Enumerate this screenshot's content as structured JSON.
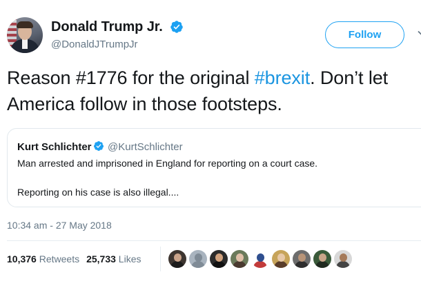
{
  "author": {
    "display_name": "Donald Trump Jr.",
    "handle": "@DonaldJTrumpJr",
    "verified": true,
    "avatar_icon": "profile-photo"
  },
  "follow_button": {
    "label": "Follow"
  },
  "tweet": {
    "text_part1": "Reason #1776 for the original ",
    "hashtag": "#brexit",
    "text_part2": ". Don’t let America follow in those footsteps."
  },
  "quoted_tweet": {
    "display_name": "Kurt Schlichter",
    "handle": "@KurtSchlichter",
    "verified": true,
    "line1": "Man arrested and imprisoned in England for reporting on a court case.",
    "line2": "Reporting on his case is also illegal...."
  },
  "timestamp": "10:34 am - 27 May 2018",
  "stats": {
    "retweets_count": "10,376",
    "retweets_label": "Retweets",
    "likes_count": "25,733",
    "likes_label": "Likes"
  },
  "likers": [
    {
      "name": "liker-avatar-1",
      "bg": "#3d3530",
      "face": "#c9a38a",
      "body": "#1c1c1c"
    },
    {
      "name": "liker-avatar-2",
      "bg": "#a9b4bf",
      "face": "#7f8b96",
      "body": "#7f8b96"
    },
    {
      "name": "liker-avatar-3",
      "bg": "#2b2b2b",
      "face": "#d1a27e",
      "body": "#111111"
    },
    {
      "name": "liker-avatar-4",
      "bg": "#6b7a5a",
      "face": "#e0c0a8",
      "body": "#4a3a30"
    },
    {
      "name": "liker-avatar-5",
      "bg": "#ffffff",
      "face": "#2f4f8f",
      "body": "#c23b3b"
    },
    {
      "name": "liker-avatar-6",
      "bg": "#c7a45a",
      "face": "#e8c9a8",
      "body": "#5a3d2a"
    },
    {
      "name": "liker-avatar-7",
      "bg": "#6d6d6d",
      "face": "#b89478",
      "body": "#2e2e2e"
    },
    {
      "name": "liker-avatar-8",
      "bg": "#3a5a3a",
      "face": "#caa58a",
      "body": "#202a20"
    },
    {
      "name": "liker-avatar-9",
      "bg": "#d8d8d8",
      "face": "#a57a5a",
      "body": "#444444"
    }
  ],
  "colors": {
    "brand_blue": "#1da1f2",
    "hashtag_blue": "#1b95e0",
    "text_primary": "#14171a",
    "text_secondary": "#657786",
    "border": "#e1e8ed"
  }
}
